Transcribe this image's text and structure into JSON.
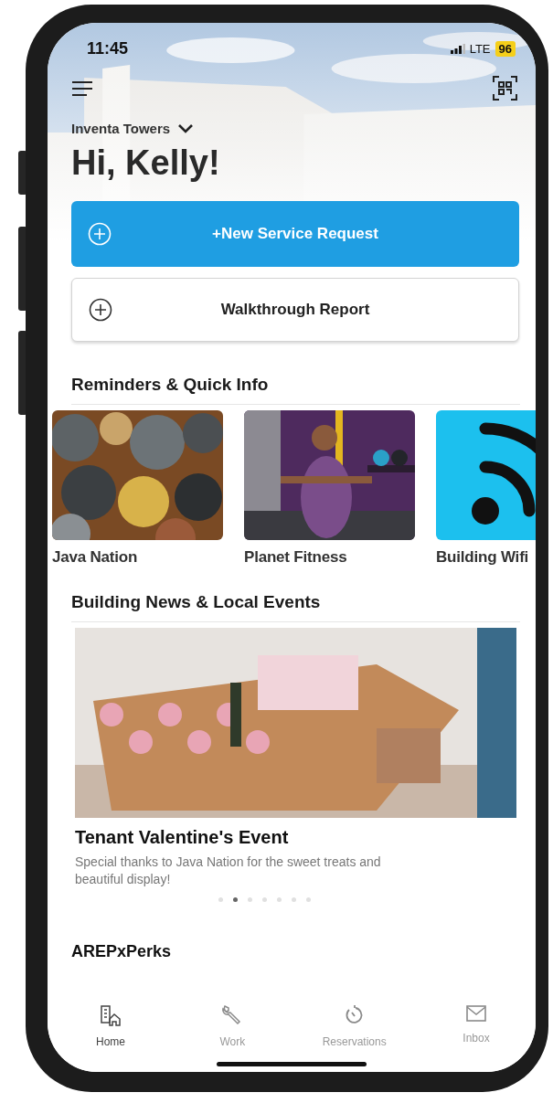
{
  "status_bar": {
    "time": "11:45",
    "network": "LTE",
    "battery": "96"
  },
  "header": {
    "location": "Inventa Towers",
    "greeting": "Hi, Kelly!"
  },
  "actions": [
    {
      "label": "+New Service Request",
      "kind": "primary"
    },
    {
      "label": "Walkthrough Report",
      "kind": "secondary"
    }
  ],
  "reminders": {
    "title": "Reminders & Quick Info",
    "cards": [
      {
        "label": "Java Nation",
        "kind": "food"
      },
      {
        "label": "Planet Fitness",
        "kind": "fitness"
      },
      {
        "label": "Building Wifi",
        "kind": "wifi"
      }
    ]
  },
  "news": {
    "title": "Building News & Local Events",
    "event": {
      "title": "Tenant Valentine's Event",
      "description": "Special thanks to Java Nation for the sweet treats and beautiful display!"
    },
    "dots": [
      {
        "selected": false
      },
      {
        "selected": true
      },
      {
        "selected": false
      },
      {
        "selected": false
      },
      {
        "selected": false
      },
      {
        "selected": false
      },
      {
        "selected": false
      }
    ]
  },
  "perks": {
    "title": "AREPxPerks"
  },
  "tabs": [
    {
      "label": "Home",
      "kind": "home",
      "selected": true
    },
    {
      "label": "Work",
      "kind": "wrench",
      "selected": false
    },
    {
      "label": "Reservations",
      "kind": "timer",
      "selected": false
    },
    {
      "label": "Inbox",
      "kind": "mail",
      "selected": false
    }
  ]
}
